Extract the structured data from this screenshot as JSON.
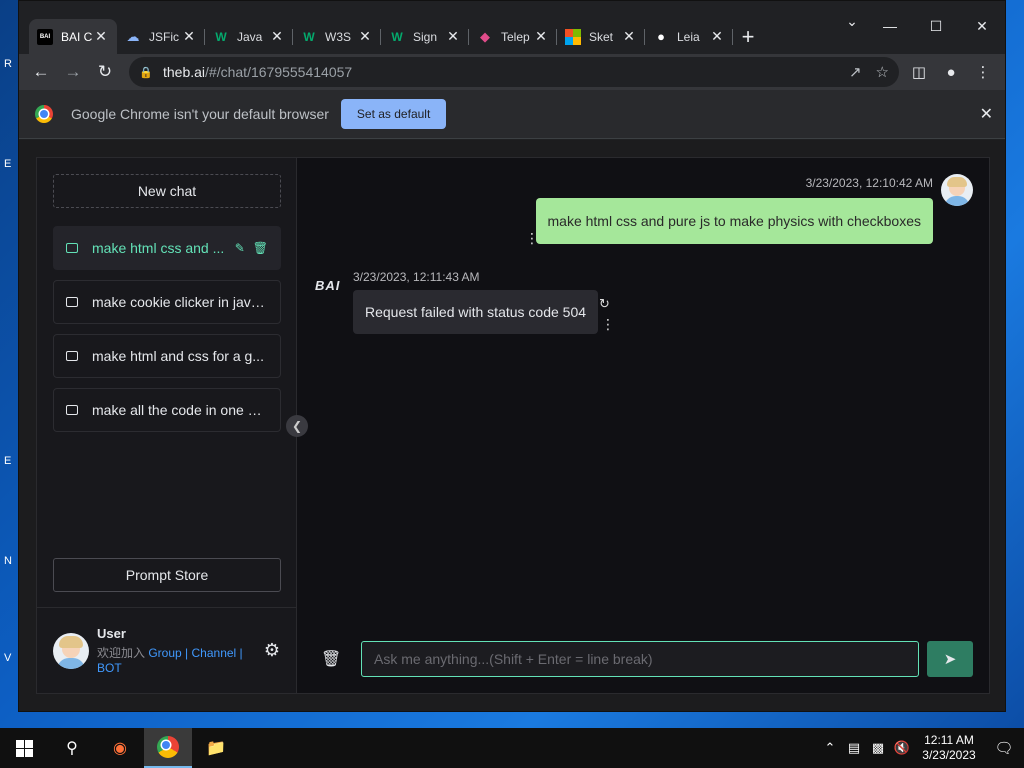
{
  "browser": {
    "tabs": [
      {
        "label": "BAI C",
        "icon": "bai-icon",
        "active": true
      },
      {
        "label": "JSFic",
        "icon": "cloud-icon"
      },
      {
        "label": "Java",
        "icon": "w3-icon"
      },
      {
        "label": "W3S",
        "icon": "w3-icon"
      },
      {
        "label": "Sign",
        "icon": "w3-icon"
      },
      {
        "label": "Telep",
        "icon": "telegraph-icon"
      },
      {
        "label": "Sket",
        "icon": "microsoft-icon"
      },
      {
        "label": "Leia",
        "icon": "leia-icon"
      }
    ],
    "url_host": "theb.ai",
    "url_path": "/#/chat/1679555414057",
    "infobar_message": "Google Chrome isn't your default browser",
    "infobar_button": "Set as default"
  },
  "sidebar": {
    "new_chat": "New chat",
    "history": [
      {
        "title": "make html css and pure js to make physics with checkboxes",
        "display": "make html css and ...",
        "active": true
      },
      {
        "title": "make cookie clicker in java...",
        "display": "make cookie clicker in java..."
      },
      {
        "title": "make html and css for a g...",
        "display": "make html and css for a g..."
      },
      {
        "title": "make all the code in one si...",
        "display": "make all the code in one si..."
      }
    ],
    "prompt_store": "Prompt Store",
    "user": {
      "name": "User",
      "desc_prefix": "欢迎加入 ",
      "link_group": "Group",
      "sep1": " | ",
      "link_channel": "Channel",
      "sep2": " | ",
      "link_bot": "BOT"
    }
  },
  "chat": {
    "user_message": {
      "timestamp": "3/23/2023, 12:10:42 AM",
      "text": "make html css and pure js to make physics with checkboxes"
    },
    "bot_message": {
      "logo": "BAI",
      "timestamp": "3/23/2023, 12:11:43 AM",
      "text": "Request failed with status code 504"
    },
    "input_placeholder": "Ask me anything...(Shift + Enter = line break)"
  },
  "taskbar": {
    "time": "12:11 AM",
    "date": "3/23/2023"
  },
  "colors": {
    "accent": "#63e2b7",
    "user_bubble": "#a5e79a",
    "link": "#4098fc",
    "chrome_button": "#8ab4f8"
  }
}
